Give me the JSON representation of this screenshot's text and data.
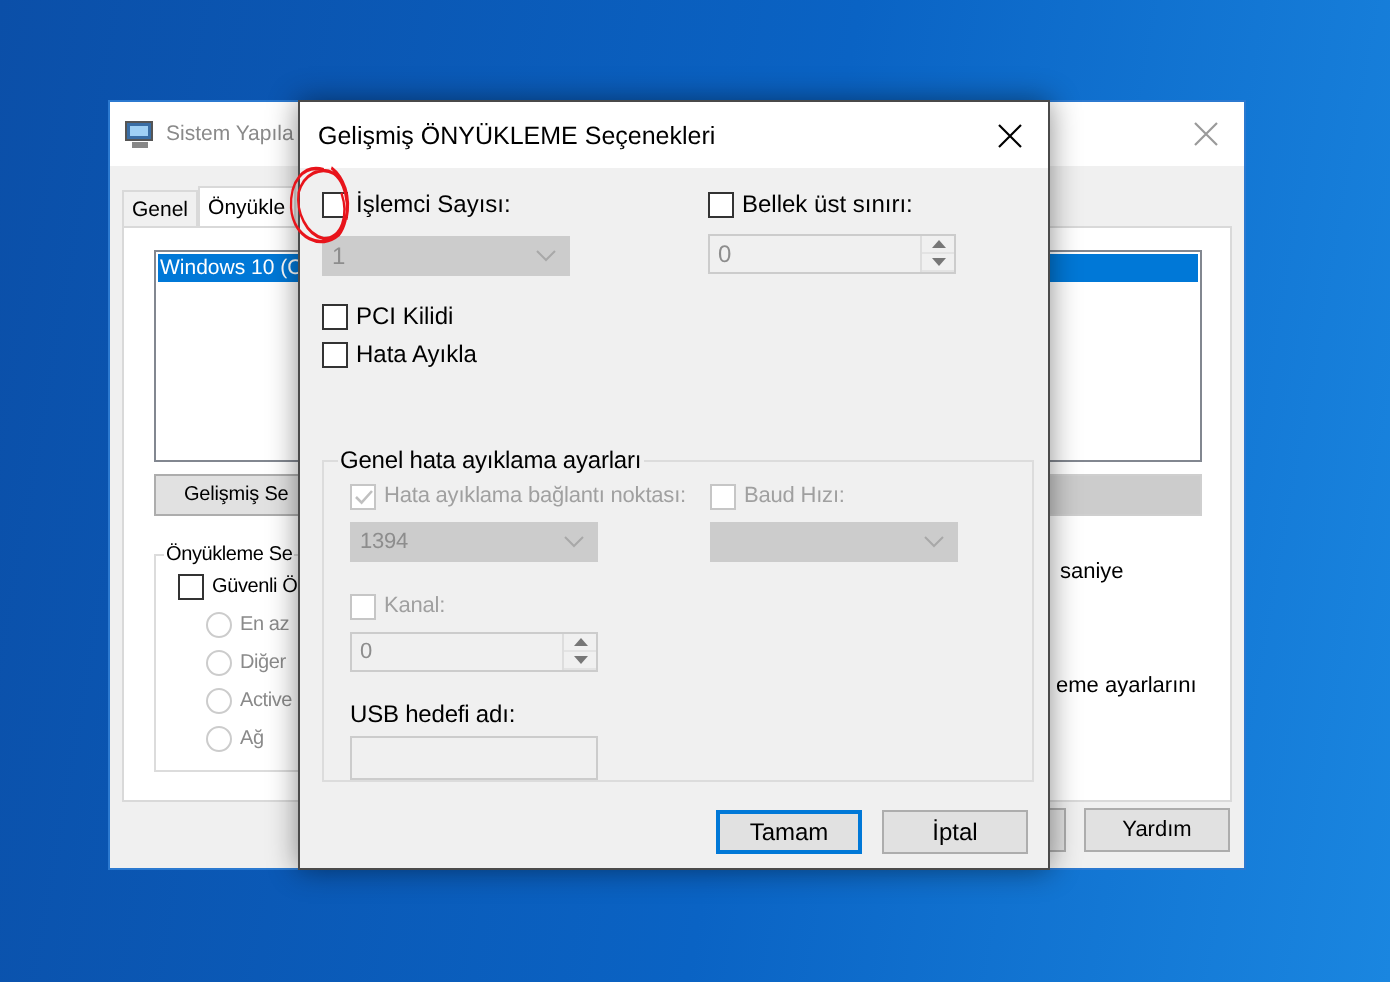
{
  "background_window": {
    "title": "Sistem Yapıla",
    "active": false,
    "tabs": [
      {
        "label": "Genel",
        "selected": false
      },
      {
        "label": "Önyükle",
        "selected": true
      }
    ],
    "boot_list": [
      {
        "label": "Windows 10 (C",
        "selected": true
      }
    ],
    "advanced_button": {
      "label": "Gelişmiş Se",
      "disabled": false
    },
    "covered_button": {
      "disabled": true
    },
    "boot_options": {
      "legend": "Önyükleme Se",
      "safe_boot": {
        "label": "Güvenli Ö",
        "checked": false,
        "disabled": false
      },
      "radios": [
        {
          "label": "En az",
          "selected": false,
          "disabled": true
        },
        {
          "label": "Diğer",
          "selected": false,
          "disabled": true
        },
        {
          "label": "Active",
          "selected": false,
          "disabled": true
        },
        {
          "label": "Ağ",
          "selected": false,
          "disabled": true
        }
      ]
    },
    "side_texts": [
      "saniye",
      "eme ayarlarını"
    ],
    "footer_buttons": [
      {
        "label": "Yardım"
      }
    ]
  },
  "dialog": {
    "title": "Gelişmiş ÖNYÜKLEME Seçenekleri",
    "processors": {
      "label": "İşlemci Sayısı:",
      "checked": false,
      "disabled": false,
      "value": "1",
      "field_disabled": true
    },
    "max_memory": {
      "label": "Bellek üst sınırı:",
      "checked": false,
      "disabled": false,
      "value": "0",
      "field_disabled": true
    },
    "pci_lock": {
      "label": "PCI Kilidi",
      "checked": false,
      "disabled": false
    },
    "debug": {
      "label": "Hata Ayıkla",
      "checked": false,
      "disabled": false
    },
    "debug_settings": {
      "legend": "Genel hata ayıklama ayarları",
      "port": {
        "label": "Hata ayıklama bağlantı noktası:",
        "checked": true,
        "disabled": true,
        "value": "1394",
        "field_disabled": true
      },
      "baud": {
        "label": "Baud Hızı:",
        "checked": false,
        "disabled": true,
        "field_disabled": true
      },
      "channel": {
        "label": "Kanal:",
        "checked": false,
        "disabled": true,
        "value": "0",
        "field_disabled": true
      },
      "usb_target": {
        "label": "USB hedefi adı:",
        "field_disabled": true
      }
    },
    "buttons": [
      {
        "label": "Tamam",
        "default": true
      },
      {
        "label": "İptal",
        "default": false
      }
    ]
  }
}
